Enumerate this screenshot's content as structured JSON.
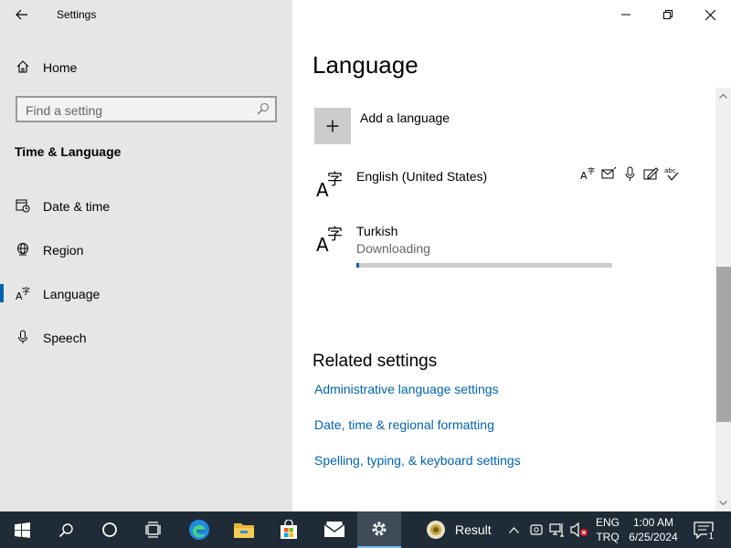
{
  "window": {
    "title": "Settings",
    "controls": {
      "minimize": "minimize",
      "maximize": "restore",
      "close": "close"
    }
  },
  "sidebar": {
    "home": "Home",
    "search_placeholder": "Find a setting",
    "section": "Time & Language",
    "items": [
      {
        "label": "Date & time",
        "icon": "calendar-clock-icon"
      },
      {
        "label": "Region",
        "icon": "globe-icon"
      },
      {
        "label": "Language",
        "icon": "language-icon",
        "active": true
      },
      {
        "label": "Speech",
        "icon": "microphone-icon"
      }
    ]
  },
  "main": {
    "title": "Language",
    "add_language": "Add a language",
    "languages": [
      {
        "name": "English (United States)",
        "status": ""
      },
      {
        "name": "Turkish",
        "status": "Downloading",
        "progress": 0.01
      }
    ],
    "related": {
      "heading": "Related settings",
      "links": [
        "Administrative language settings",
        "Date, time & regional formatting",
        "Spelling, typing, & keyboard settings"
      ]
    }
  },
  "taskbar": {
    "apps": [
      "start",
      "search",
      "cortana",
      "task-view",
      "edge",
      "file-explorer",
      "store",
      "mail",
      "settings"
    ],
    "result_label": "Result",
    "lang_top": "ENG",
    "lang_bottom": "TRQ",
    "time": "1:00 AM",
    "date": "6/25/2024",
    "notifications": "1"
  },
  "colors": {
    "accent": "#0063b1",
    "taskbar": "#1f2b36",
    "sidebar": "#e6e6e6"
  }
}
